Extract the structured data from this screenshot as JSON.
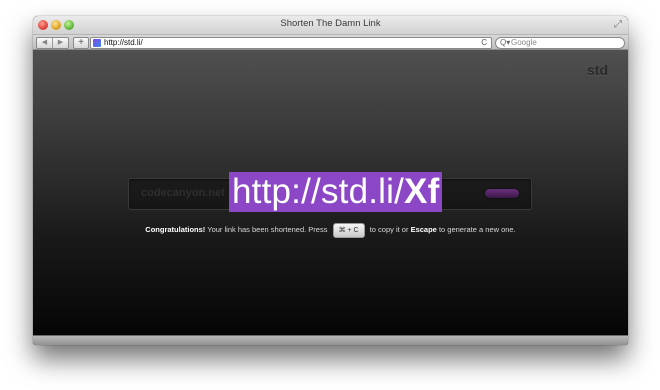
{
  "window": {
    "title": "Shorten The Damn Link"
  },
  "toolbar": {
    "back_glyph": "◀",
    "forward_glyph": "▶",
    "add_glyph": "+",
    "url": "http://std.li/",
    "reload_glyph": "C",
    "search_glyph": "Q▾",
    "search_placeholder": "Google"
  },
  "page": {
    "logo": "std",
    "input_value": "codecanyon.net",
    "short_url_prefix": "http://std.li/",
    "short_url_code": "Xf",
    "message": {
      "congrats": "Congratulations!",
      "text_before_key": "Your link has been shortened. Press",
      "copy_key": "⌘ + C",
      "text_after_key": "to copy it or",
      "escape_key": "Escape",
      "text_end": "to generate a new one."
    }
  },
  "colors": {
    "highlight": "#8c47c7",
    "button": "#5a2a6c"
  },
  "icons": {
    "close": "close-icon",
    "minimize": "minimize-icon",
    "zoom": "zoom-icon",
    "fullscreen": "fullscreen-icon",
    "reload": "reload-icon",
    "search": "search-icon"
  }
}
